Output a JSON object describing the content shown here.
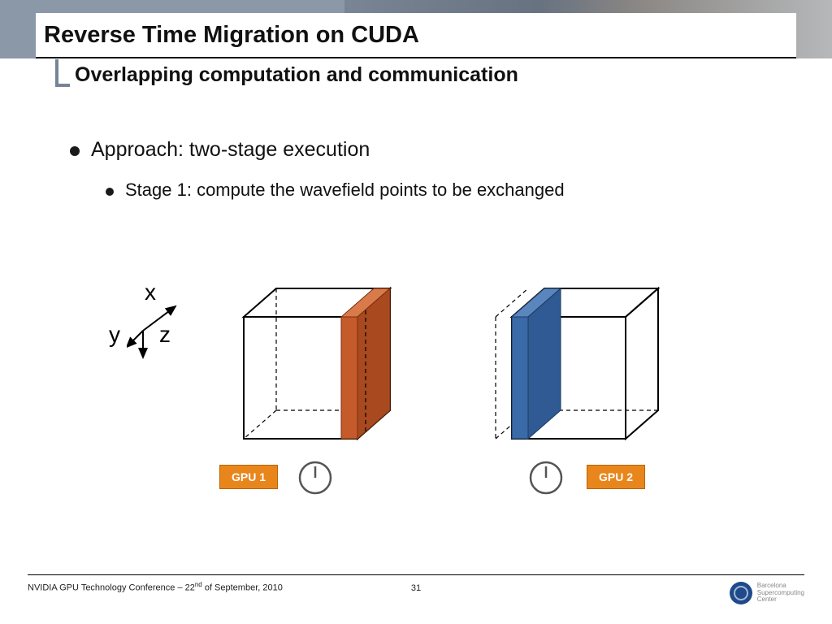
{
  "header": {
    "title": "Reverse Time Migration on CUDA",
    "subtitle": "Overlapping computation and communication"
  },
  "bullets": {
    "level1": "Approach: two-stage execution",
    "level2": "Stage 1: compute the wavefield points to be exchanged"
  },
  "diagram": {
    "axes": {
      "x": "x",
      "y": "y",
      "z": "z"
    },
    "gpu1_label": "GPU 1",
    "gpu2_label": "GPU 2"
  },
  "footer": {
    "conference_prefix": "NVIDIA GPU Technology Conference – 22",
    "conference_suffix": " of September, 2010",
    "ordinal": "nd",
    "page": "31",
    "logo_text": "Barcelona\nSupercomputing\nCenter"
  }
}
